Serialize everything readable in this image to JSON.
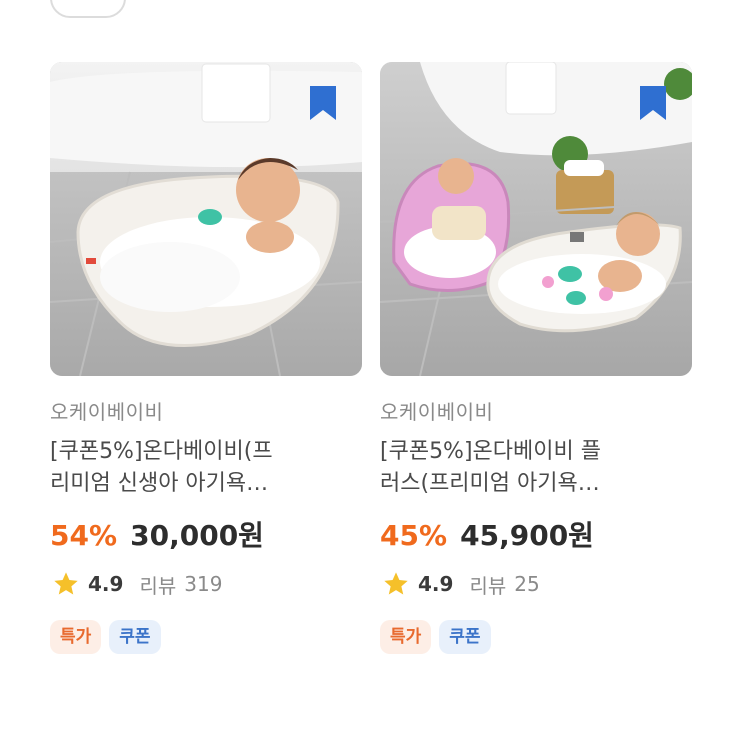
{
  "products": [
    {
      "brand": "오케이베이비",
      "title_line1": "[쿠폰5%]온다베이비(프",
      "title_line2": "리미엄 신생아 아기욕…",
      "discount": "54%",
      "price": "30,000원",
      "rating": "4.9",
      "review_label": "리뷰",
      "review_count": "319",
      "badges": [
        "특가",
        "쿠폰"
      ]
    },
    {
      "brand": "오케이베이비",
      "title_line1": "[쿠폰5%]온다베이비 플",
      "title_line2": "러스(프리미엄 아기욕…",
      "discount": "45%",
      "price": "45,900원",
      "rating": "4.9",
      "review_label": "리뷰",
      "review_count": "25",
      "badges": [
        "특가",
        "쿠폰"
      ]
    }
  ],
  "colors": {
    "discount": "#f06a1d",
    "bookmark": "#2f6fd1",
    "star": "#f5c02a",
    "badge_special_bg": "#fdeee6",
    "badge_special_text": "#e86a2e",
    "badge_coupon_bg": "#e8f0fb",
    "badge_coupon_text": "#3c74c9"
  }
}
